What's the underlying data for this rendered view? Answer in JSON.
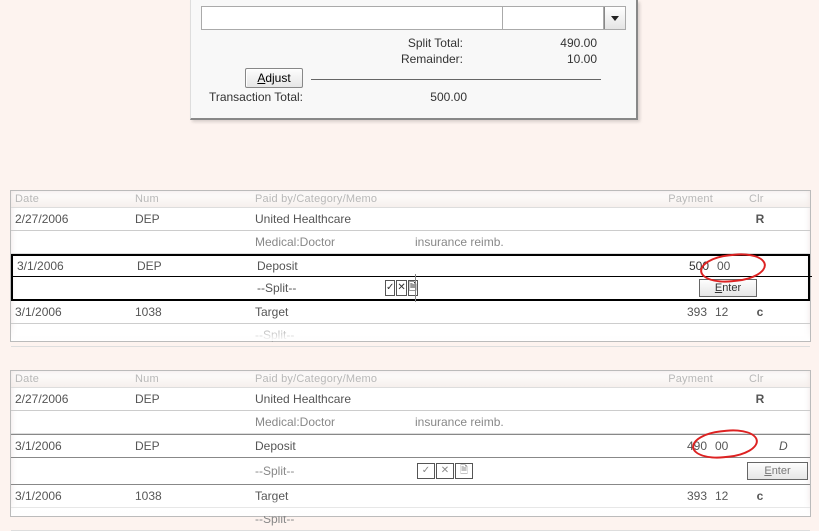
{
  "split_panel": {
    "adjust_label": "Adjust",
    "split_total_label": "Split Total:",
    "split_total_value": "490.00",
    "remainder_label": "Remainder:",
    "remainder_value": "10.00",
    "transaction_total_label": "Transaction Total:",
    "transaction_total_value": "500.00"
  },
  "columns": {
    "date": "Date",
    "num": "Num",
    "paid": "Paid by/Category/Memo",
    "payment": "Payment",
    "clr": "Clr"
  },
  "register_a": {
    "rows": [
      {
        "date": "2/27/2006",
        "num": "DEP",
        "payee": "United Healthcare",
        "category": "Medical:Doctor",
        "memo": "insurance reimb.",
        "clr": "R"
      },
      {
        "date": "3/1/2006",
        "num": "DEP",
        "payee": "Deposit",
        "category": "--Split--",
        "amount_whole": "500",
        "amount_cents": "00",
        "enter_label": "Enter"
      },
      {
        "date": "3/1/2006",
        "num": "1038",
        "payee": "Target",
        "category": "--Split--",
        "amount_whole": "393",
        "amount_cents": "12",
        "clr": "c"
      }
    ]
  },
  "register_b": {
    "rows": [
      {
        "date": "2/27/2006",
        "num": "DEP",
        "payee": "United Healthcare",
        "category": "Medical:Doctor",
        "memo": "insurance reimb.",
        "clr": "R"
      },
      {
        "date": "3/1/2006",
        "num": "DEP",
        "payee": "Deposit",
        "category": "--Split--",
        "amount_whole": "490",
        "amount_cents": "00",
        "enter_label": "Enter",
        "extra": "D"
      },
      {
        "date": "3/1/2006",
        "num": "1038",
        "payee": "Target",
        "category": "--Split--",
        "amount_whole": "393",
        "amount_cents": "12",
        "clr": "c"
      }
    ]
  },
  "icons": {
    "check": "✓",
    "x": "✕",
    "doc": "🗎"
  }
}
